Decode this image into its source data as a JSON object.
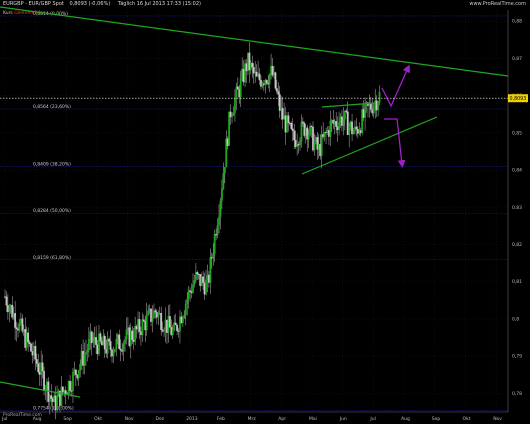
{
  "header": {
    "symbol": "EURGBP",
    "instrument": "EUR/GBP Spot",
    "quote": "0,8093 (-0,06%)",
    "timeframe": "Täglich",
    "datetime": "16 Jul 2013 17:33 (15:02)"
  },
  "legend": {
    "label": "Kurs",
    "indicator": "Gleitend 14"
  },
  "watermark_top": "www.ProRealTime.com",
  "watermark_bottom": "ProRealTime.com",
  "current_price_label": "0,8093",
  "colors": {
    "background": "#000000",
    "candle": "#c8c8c8",
    "trendline": "#1fa81f",
    "arrow": "#a020c8",
    "fib": "#1a1aa0",
    "price_line": "#ffffff"
  },
  "chart_data": {
    "type": "candlestick",
    "x_ticks": [
      "Jul",
      "Aug",
      "Sep",
      "Okt",
      "Nov",
      "Dez",
      "2013",
      "Feb",
      "Mrz",
      "Apr",
      "Mai",
      "Jun",
      "Jul",
      "Aug",
      "Sep",
      "Okt",
      "Nov"
    ],
    "y_ticks": [
      "0,88",
      "0,87",
      "0,86",
      "0,85",
      "0,84",
      "0,83",
      "0,82",
      "0,81",
      "0,8",
      "0,79",
      "0,78"
    ],
    "y_range": [
      0.775,
      0.883
    ],
    "fib_levels": [
      {
        "label": "0,8814 (0,00%)",
        "value": 0.8814
      },
      {
        "label": "0,8564 (23,60%)",
        "value": 0.8564
      },
      {
        "label": "0,8409 (38,20%)",
        "value": 0.8409
      },
      {
        "label": "0,8284 (50,00%)",
        "value": 0.8284
      },
      {
        "label": "0,8159 (61,80%)",
        "value": 0.8159
      },
      {
        "label": "0,7754 (100,00%)",
        "value": 0.7754
      }
    ],
    "last_price": 0.8593,
    "price_path": [
      [
        0.0,
        0.806
      ],
      [
        1.0,
        0.789
      ],
      [
        1.6,
        0.777
      ],
      [
        2.2,
        0.784
      ],
      [
        2.8,
        0.794
      ],
      [
        3.4,
        0.792
      ],
      [
        4.2,
        0.796
      ],
      [
        4.9,
        0.802
      ],
      [
        5.5,
        0.796
      ],
      [
        6.0,
        0.807
      ],
      [
        6.2,
        0.811
      ],
      [
        6.6,
        0.809
      ],
      [
        7.0,
        0.832
      ],
      [
        7.35,
        0.856
      ],
      [
        7.6,
        0.861
      ],
      [
        7.9,
        0.869
      ],
      [
        8.2,
        0.864
      ],
      [
        8.7,
        0.866
      ],
      [
        9.0,
        0.855
      ],
      [
        9.4,
        0.848
      ],
      [
        9.8,
        0.852
      ],
      [
        10.2,
        0.845
      ],
      [
        10.6,
        0.852
      ],
      [
        11.0,
        0.854
      ],
      [
        11.4,
        0.85
      ],
      [
        11.8,
        0.856
      ],
      [
        12.2,
        0.86
      ]
    ]
  }
}
